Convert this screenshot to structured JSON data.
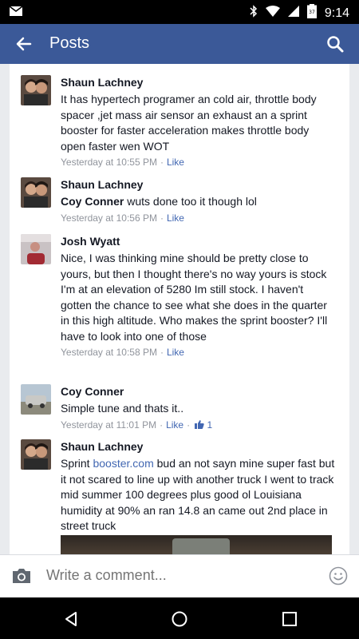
{
  "status_bar": {
    "time": "9:14",
    "battery_level": "37"
  },
  "header": {
    "title": "Posts"
  },
  "comments": [
    {
      "author": "Shaun Lachney",
      "text": "It has hypertech programer an cold air, throttle body spacer ,jet mass air sensor an exhaust an a sprint booster for faster acceleration makes throttle body open faster wen WOT",
      "timestamp": "Yesterday at 10:55 PM",
      "like_label": "Like"
    },
    {
      "author": "Shaun Lachney",
      "mention": "Coy Conner",
      "text": " wuts done too it though lol",
      "timestamp": "Yesterday at 10:56 PM",
      "like_label": "Like"
    },
    {
      "author": "Josh Wyatt",
      "text": "Nice, I was thinking mine should be pretty close to yours, but then I thought there's no way yours is stock  I'm at an elevation of 5280 Im still stock. I haven't gotten the chance to see what she does in the quarter in this high altitude. Who makes the sprint booster? I'll have to look into one of those",
      "timestamp": "Yesterday at 10:58 PM",
      "like_label": "Like"
    },
    {
      "author": "Coy Conner",
      "text": "Simple tune and thats it..",
      "timestamp": "Yesterday at 11:01 PM",
      "like_label": "Like",
      "like_count": "1"
    },
    {
      "author": "Shaun Lachney",
      "text_before": "Sprint ",
      "link_text": "booster.com",
      "text_after": " bud an not sayn mine super fast but it not scared to line up with another truck I went to track mid summer 100 degrees plus good ol Louisiana humidity at 90% an ran 14.8 an came out 2nd place in street truck"
    }
  ],
  "composer": {
    "placeholder": "Write a comment..."
  },
  "colors": {
    "brand": "#3b5998",
    "link": "#4267b2",
    "meta": "#90949c"
  }
}
